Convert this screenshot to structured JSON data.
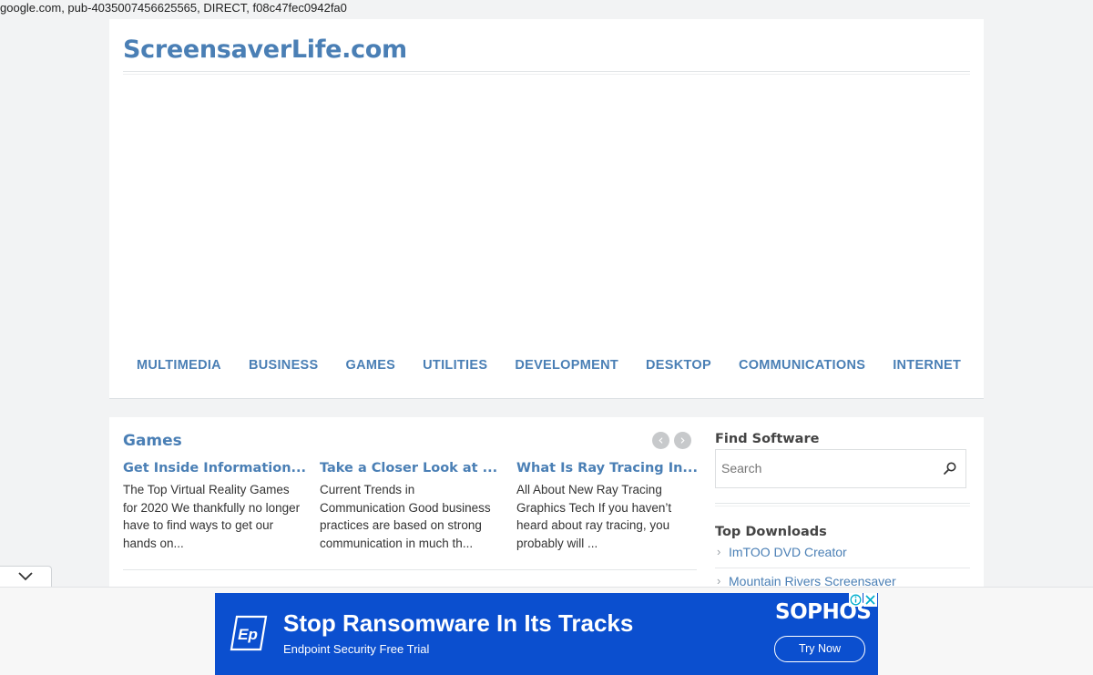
{
  "ads_txt_line": "google.com, pub-4035007456625565, DIRECT, f08c47fec0942fa0",
  "site": {
    "title": "ScreensaverLife.com"
  },
  "nav": [
    "MULTIMEDIA",
    "BUSINESS",
    "GAMES",
    "UTILITIES",
    "DEVELOPMENT",
    "DESKTOP",
    "COMMUNICATIONS",
    "INTERNET"
  ],
  "section": {
    "title": "Games",
    "prev_icon": "chevron-left-icon",
    "next_icon": "chevron-right-icon",
    "posts": [
      {
        "title": "Get Inside Information...",
        "excerpt": "The Top Virtual Reality Games for 2020 We thankfully no longer have to find ways to get our hands on..."
      },
      {
        "title": "Take a Closer Look at ...",
        "excerpt": "Current Trends in Communication Good business practices are based on strong communication in much th..."
      },
      {
        "title": "What Is Ray Tracing In...",
        "excerpt": "All About New Ray Tracing Graphics Tech If you haven’t heard about ray tracing, you probably will ..."
      }
    ]
  },
  "sidebar": {
    "find_title": "Find Software",
    "search_placeholder": "Search",
    "downloads_title": "Top Downloads",
    "downloads": [
      "ImTOO DVD Creator",
      "Mountain Rivers Screensaver"
    ]
  },
  "ad": {
    "logo_text": "Ep",
    "headline": "Stop Ransomware In Its Tracks",
    "sub": "Endpoint Security Free Trial",
    "brand": "SOPHOS",
    "cta": "Try Now",
    "bg_color": "#0b4fcf"
  },
  "colors": {
    "link": "#4a7fb5",
    "page_bg": "#f2f3f4"
  }
}
